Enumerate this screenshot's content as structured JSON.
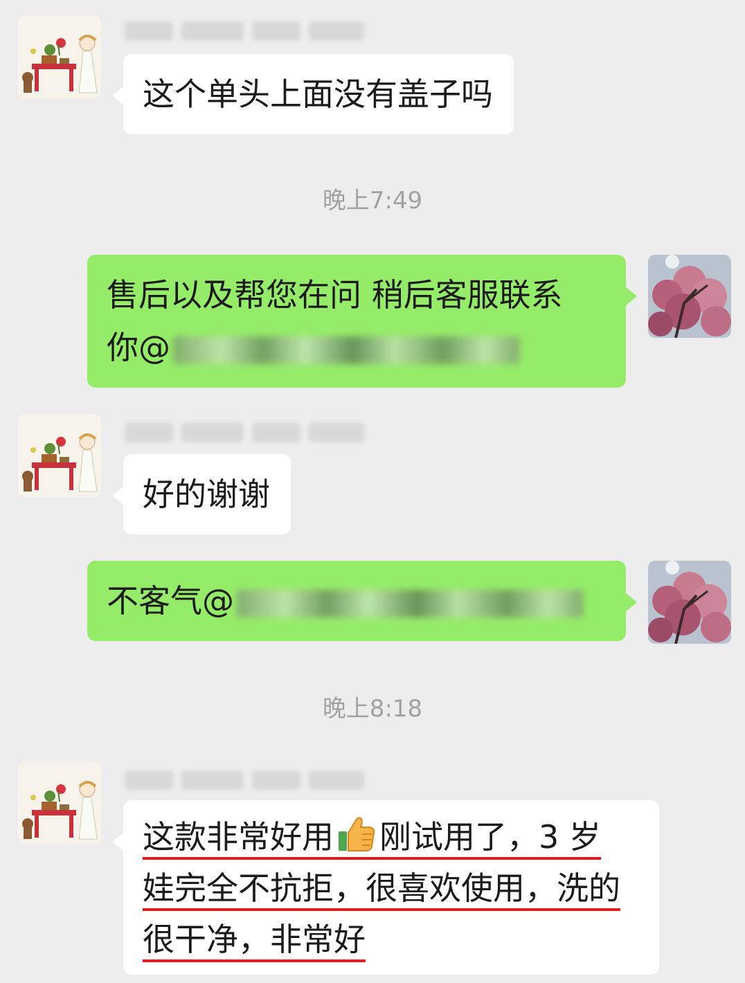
{
  "colors": {
    "background": "#ededed",
    "incoming_bubble": "#ffffff",
    "outgoing_bubble": "#95ec69",
    "timestamp_text": "#a2a2a2",
    "underline_markup": "#e01e1e"
  },
  "messages": [
    {
      "side": "incoming",
      "sender_name": "[blurred]",
      "avatar": "cartoon-girl-avatar",
      "text": "这个单头上面没有盖子吗"
    },
    {
      "type": "timestamp",
      "text": "晚上7:49"
    },
    {
      "side": "outgoing",
      "avatar": "cherry-blossom-avatar",
      "line1": "售后以及帮您在问 稍后客服联系",
      "line2_prefix": "你@",
      "mention": "[blurred]"
    },
    {
      "side": "incoming",
      "sender_name": "[blurred]",
      "avatar": "cartoon-girl-avatar",
      "text": "好的谢谢"
    },
    {
      "side": "outgoing",
      "avatar": "cherry-blossom-avatar",
      "text_prefix": "不客气@",
      "mention": "[blurred]"
    },
    {
      "type": "timestamp",
      "text": "晚上8:18"
    },
    {
      "side": "incoming",
      "sender_name": "[blurred]",
      "avatar": "cartoon-girl-avatar",
      "line1_before_emoji": "这款非常好用",
      "emoji": "thumbs-up-icon",
      "line1_after_emoji": "刚试用了，3 岁",
      "line2": "娃完全不抗拒，很喜欢使用，洗的",
      "line3": "很干净，非常好",
      "underlined": true
    }
  ]
}
